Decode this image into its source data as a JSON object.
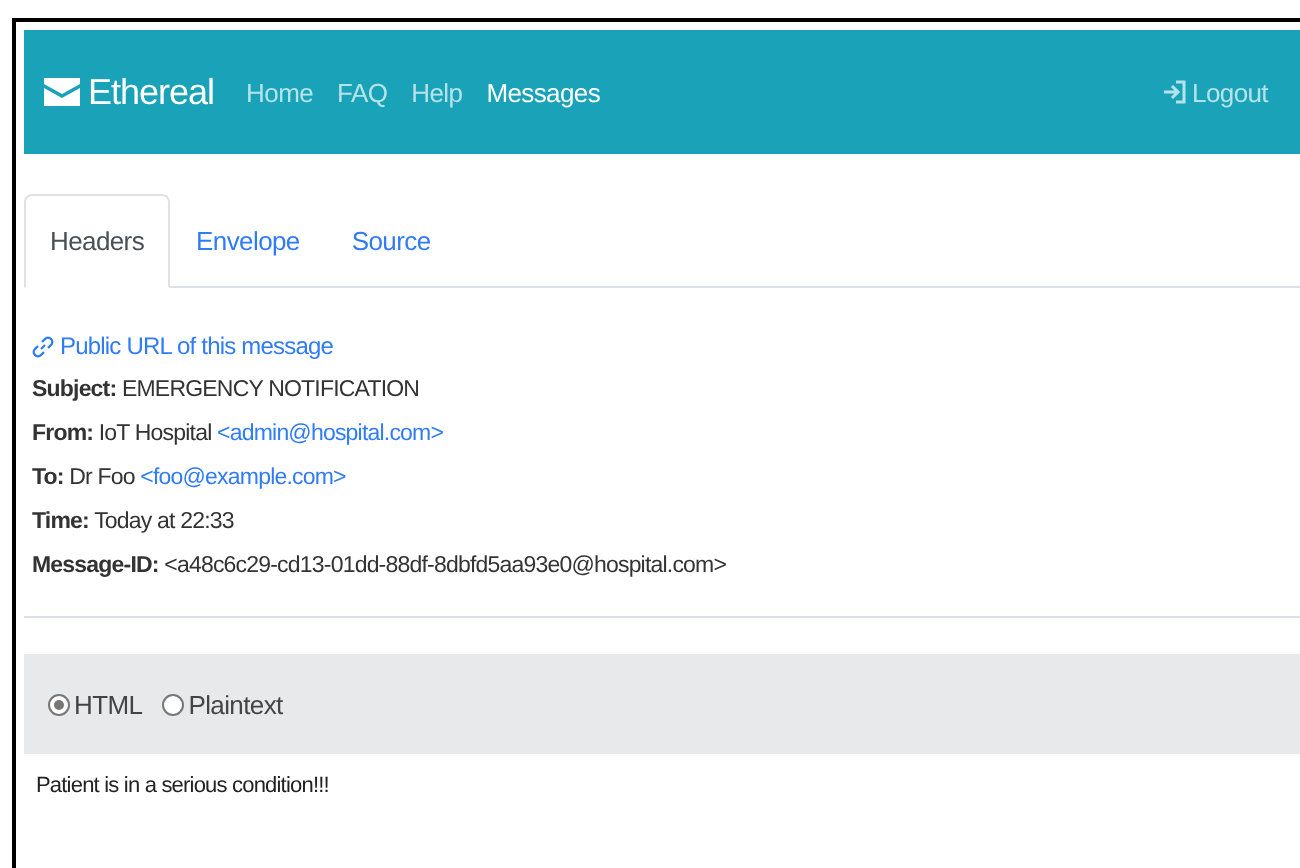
{
  "navbar": {
    "brand": "Ethereal",
    "links": [
      {
        "label": "Home",
        "selected": false
      },
      {
        "label": "FAQ",
        "selected": false
      },
      {
        "label": "Help",
        "selected": false
      },
      {
        "label": "Messages",
        "selected": true
      }
    ],
    "logout": "Logout"
  },
  "tabs": [
    {
      "label": "Headers",
      "selected": true
    },
    {
      "label": "Envelope",
      "selected": false
    },
    {
      "label": "Source",
      "selected": false
    }
  ],
  "public_url": "Public URL of this message",
  "headers": [
    {
      "label": "Subject:",
      "value": "EMERGENCY NOTIFICATION"
    },
    {
      "label": "From:",
      "value": "IoT Hospital",
      "email": "<admin@hospital.com>"
    },
    {
      "label": "To:",
      "value": "Dr Foo",
      "email": "<foo@example.com>"
    },
    {
      "label": "Time:",
      "value": "Today at 22:33"
    },
    {
      "label": "Message-ID:",
      "value": "<a48c6c29-cd13-01dd-88df-8dbfd5aa93e0@hospital.com>"
    }
  ],
  "formats": [
    {
      "label": "HTML",
      "selected": true
    },
    {
      "label": "Plaintext",
      "selected": false
    }
  ],
  "body": "Patient is in a serious condition!!!"
}
